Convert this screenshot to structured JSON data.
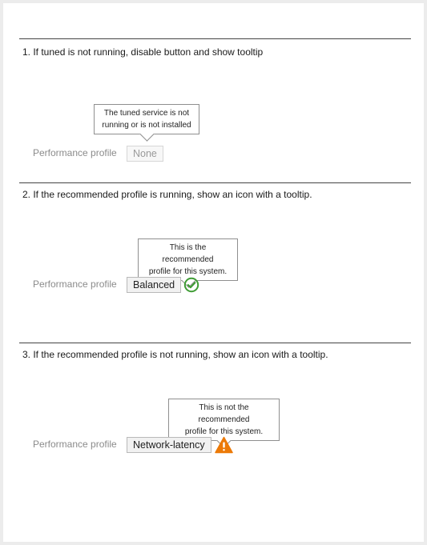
{
  "sections": [
    {
      "heading": "1. If tuned is not running, disable button and show tooltip",
      "tooltip_line1": "The tuned service is not",
      "tooltip_line2": "running or is not installed",
      "field_label": "Performance profile",
      "button_label": "None"
    },
    {
      "heading": "2. If the recommended profile is running, show an icon with a tooltip.",
      "tooltip_line1": "This is the recommended",
      "tooltip_line2": "profile for this system.",
      "field_label": "Performance profile",
      "button_label": "Balanced",
      "icon": "check-circle-icon",
      "icon_color": "#3f9c35"
    },
    {
      "heading": "3. If the recommended profile is not running, show an icon with a tooltip.",
      "tooltip_line1": "This is not the recommended",
      "tooltip_line2": "profile for this system.",
      "field_label": "Performance profile",
      "button_label": "Network-latency",
      "icon": "warning-triangle-icon",
      "icon_color": "#ec7a08"
    }
  ]
}
